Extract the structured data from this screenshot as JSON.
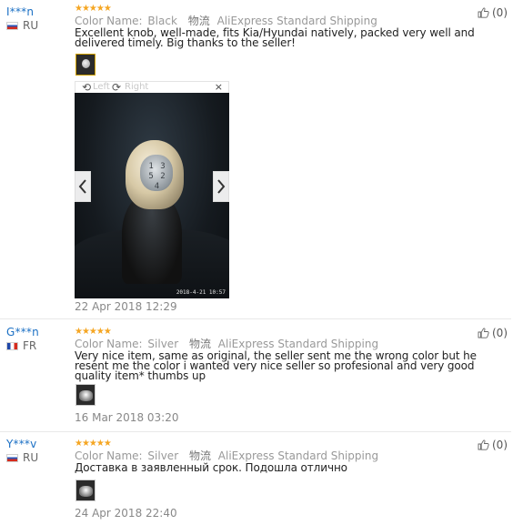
{
  "reviews": [
    {
      "user": "I***n",
      "country": "RU",
      "stars": "★★★★★",
      "color_label": "Color Name:",
      "color_value": "Black",
      "shipping_icon_text": "物流",
      "shipping": "AliExpress Standard Shipping",
      "text": "Excellent knob, well-made, fits Kia/Hyundai natively, packed very well and delivered timely. Big thanks to the seller!",
      "helpful_count": "(0)",
      "date": "22 Apr 2018 12:29"
    },
    {
      "user": "G***n",
      "country": "FR",
      "stars": "★★★★★",
      "color_label": "Color Name:",
      "color_value": "Silver",
      "shipping_icon_text": "物流",
      "shipping": "AliExpress Standard Shipping",
      "text": "Very nice item, same as original, the seller sent me the wrong color but he resent me the color i wanted very nice seller so profesional and very good quality item* thumbs up",
      "helpful_count": "(0)",
      "date": "16 Mar 2018 03:20"
    },
    {
      "user": "Y***v",
      "country": "RU",
      "stars": "★★★★★",
      "color_label": "Color Name:",
      "color_value": "Silver",
      "shipping_icon_text": "物流",
      "shipping": "AliExpress Standard Shipping",
      "text": "Доставка в заявленный срок. Подошла отлично",
      "helpful_count": "(0)",
      "date": "24 Apr 2018 22:40"
    }
  ],
  "viewer": {
    "left_label": "Left",
    "right_label": "Right",
    "close": "×",
    "rotate_left_icon": "rotate-left-icon",
    "rotate_right_icon": "rotate-right-icon",
    "prev_icon": "chevron-left-icon",
    "next_icon": "chevron-right-icon",
    "photo_digits": "1 3 5 2 4",
    "photo_timestamp": "2018-4-21 10:57"
  },
  "colors": {
    "username": "#1a6fc4",
    "stars": "#f5a623",
    "meta": "#999999"
  }
}
